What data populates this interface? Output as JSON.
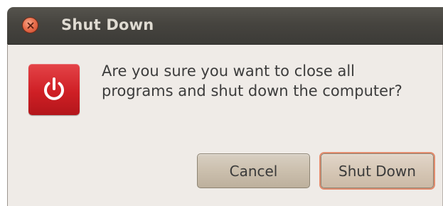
{
  "window": {
    "title": "Shut Down"
  },
  "dialog": {
    "message_line1": "Are you sure you want to close all",
    "message_line2": "programs and shut down the computer?",
    "icon": "power-icon"
  },
  "buttons": {
    "cancel_label": "Cancel",
    "shutdown_label": "Shut Down"
  },
  "colors": {
    "titlebar": "#3c3b37",
    "close_button": "#e8704e",
    "icon_background": "#cf1f25",
    "dialog_background": "#efebe7",
    "default_button_focus": "#e28c6e"
  }
}
